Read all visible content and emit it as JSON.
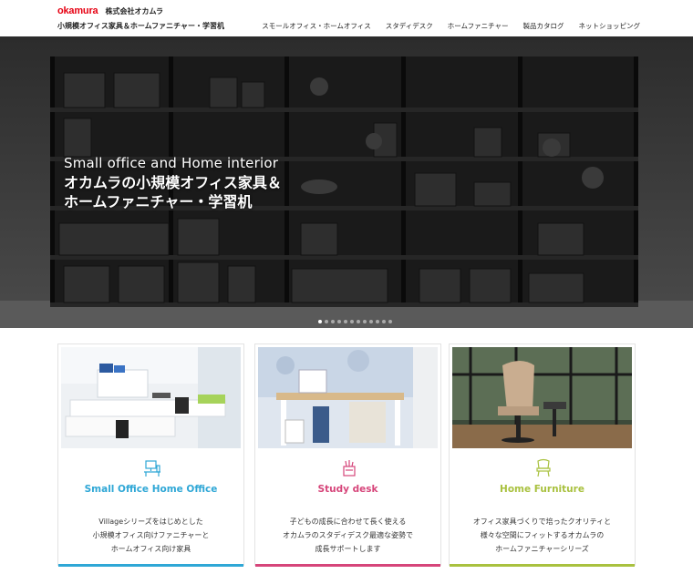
{
  "header": {
    "logo": "okamura",
    "company": "株式会社オカムラ",
    "site_title": "小規模オフィス家具＆ホームファニチャー・学習机"
  },
  "nav": [
    {
      "label": "スモールオフィス・ホームオフィス"
    },
    {
      "label": "スタディデスク"
    },
    {
      "label": "ホームファニチャー"
    },
    {
      "label": "製品カタログ"
    },
    {
      "label": "ネットショッピング"
    }
  ],
  "hero": {
    "en": "Small office and Home interior",
    "jp_line1": "オカムラの小規模オフィス家具＆",
    "jp_line2": "ホームファニチャー・学習机",
    "slide_count": 12,
    "active_slide": 1
  },
  "cards": [
    {
      "title": "Small Office Home Office",
      "color": "#2fa7d6",
      "icon": "desk-computer-icon",
      "desc": [
        "Villageシリーズをはじめとした",
        "小規模オフィス向けファニチャーと",
        "ホームオフィス向け家具"
      ]
    },
    {
      "title": "Study desk",
      "color": "#d6457a",
      "icon": "pen-cup-icon",
      "desc": [
        "子どもの成長に合わせて長く使える",
        "オカムラのスタディデスク最適な姿勢で",
        "成長サポートします"
      ]
    },
    {
      "title": "Home Furniture",
      "color": "#a9c13f",
      "icon": "chair-icon",
      "desc": [
        "オフィス家具づくりで培ったクオリティと",
        "様々な空間にフィットするオカムラの",
        "ホームファニチャーシリーズ"
      ]
    }
  ]
}
